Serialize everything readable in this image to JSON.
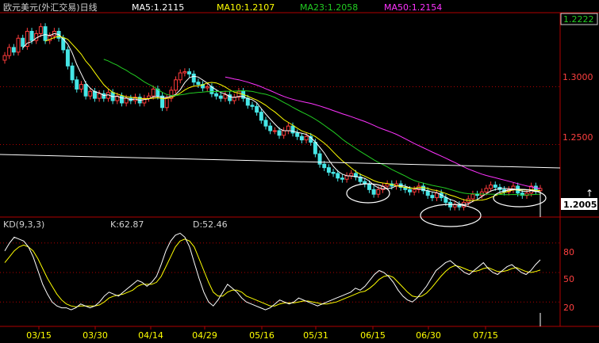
{
  "title": "欧元美元(外汇交易)日线",
  "header": {
    "ma5": "MA5:1.2115",
    "ma10": "MA10:1.2107",
    "ma23": "MA23:1.2058",
    "ma50": "MA50:1.2154"
  },
  "colors": {
    "background": "#000000",
    "frame": "#b00000",
    "up_candle": "#ff3c3c",
    "down_candle": "#46e6e6",
    "ma5": "#ffffff",
    "ma10": "#ffff00",
    "ma23": "#22cc22",
    "ma50": "#ff33ff",
    "title_text": "#d0d0d0",
    "ma5_text": "#ffffff",
    "ma10_text": "#ffff00",
    "ma23_text": "#22cc22",
    "ma50_text": "#ff33ff",
    "axis_text": "#ff4040",
    "date_text": "#ffff00",
    "k_line": "#ffffff",
    "d_line": "#ffff00",
    "trend_line": "#ffffff",
    "ellipse": "#ffffff"
  },
  "price_axis": {
    "ticks": [
      "1.3000",
      "1.2500"
    ],
    "last_price_box": "1.2222",
    "cursor_price": "1.2005"
  },
  "kd_panel": {
    "label": "KD(9,3,3)",
    "k": "K:62.87",
    "d": "D:52.46",
    "ticks": [
      "80",
      "50",
      "20"
    ]
  },
  "chart_data": {
    "type": "candlestick",
    "title": "欧元美元(外汇交易)日线",
    "x_ticks": [
      "03/15",
      "03/30",
      "04/14",
      "04/29",
      "05/16",
      "05/31",
      "06/15",
      "06/30",
      "07/15"
    ],
    "price_ylim": [
      1.19,
      1.36
    ],
    "price_ticks": [
      1.3,
      1.25
    ],
    "closes": [
      1.327,
      1.334,
      1.33,
      1.342,
      1.335,
      1.348,
      1.34,
      1.346,
      1.352,
      1.34,
      1.344,
      1.348,
      1.342,
      1.332,
      1.318,
      1.306,
      1.298,
      1.302,
      1.292,
      1.296,
      1.29,
      1.294,
      1.29,
      1.295,
      1.288,
      1.292,
      1.286,
      1.29,
      1.288,
      1.291,
      1.286,
      1.29,
      1.292,
      1.298,
      1.292,
      1.282,
      1.29,
      1.297,
      1.306,
      1.312,
      1.313,
      1.311,
      1.304,
      1.302,
      1.299,
      1.3,
      1.294,
      1.292,
      1.29,
      1.293,
      1.288,
      1.291,
      1.296,
      1.29,
      1.284,
      1.283,
      1.278,
      1.271,
      1.266,
      1.262,
      1.262,
      1.258,
      1.262,
      1.266,
      1.26,
      1.257,
      1.254,
      1.257,
      1.252,
      1.242,
      1.233,
      1.23,
      1.226,
      1.225,
      1.221,
      1.22,
      1.223,
      1.225,
      1.222,
      1.218,
      1.216,
      1.211,
      1.207,
      1.211,
      1.214,
      1.216,
      1.214,
      1.216,
      1.213,
      1.211,
      1.209,
      1.211,
      1.214,
      1.21,
      1.206,
      1.204,
      1.208,
      1.204,
      1.2,
      1.196,
      1.198,
      1.196,
      1.2,
      1.203,
      1.207,
      1.206,
      1.209,
      1.212,
      1.215,
      1.213,
      1.211,
      1.209,
      1.211,
      1.214,
      1.208,
      1.206,
      1.208,
      1.214,
      1.21,
      1.212
    ],
    "ma5": "MA5:1.2115",
    "ma10": "MA10:1.2107",
    "ma23": "MA23:1.2058",
    "ma50": "MA50:1.2154",
    "kd": {
      "ylim": [
        0,
        100
      ],
      "ticks": [
        80,
        50,
        20
      ],
      "k_last": 62.87,
      "d_last": 52.46,
      "k": [
        72,
        80,
        86,
        84,
        82,
        76,
        66,
        52,
        38,
        28,
        20,
        16,
        14,
        14,
        12,
        14,
        18,
        16,
        14,
        16,
        20,
        26,
        30,
        28,
        26,
        30,
        34,
        38,
        42,
        40,
        36,
        40,
        46,
        58,
        72,
        82,
        88,
        90,
        86,
        76,
        60,
        44,
        30,
        20,
        16,
        22,
        30,
        38,
        34,
        30,
        24,
        20,
        18,
        16,
        14,
        12,
        14,
        18,
        22,
        20,
        18,
        20,
        24,
        22,
        20,
        18,
        16,
        18,
        20,
        22,
        24,
        26,
        28,
        30,
        34,
        32,
        36,
        42,
        48,
        52,
        50,
        46,
        40,
        32,
        26,
        22,
        20,
        24,
        30,
        36,
        44,
        52,
        56,
        60,
        62,
        58,
        54,
        50,
        48,
        52,
        56,
        60,
        54,
        50,
        48,
        52,
        56,
        58,
        54,
        50,
        48,
        52,
        58,
        62.87
      ],
      "d": [
        60,
        66,
        72,
        76,
        78,
        76,
        72,
        64,
        54,
        44,
        36,
        28,
        22,
        18,
        16,
        15,
        16,
        16,
        16,
        16,
        17,
        20,
        24,
        26,
        27,
        28,
        30,
        32,
        36,
        38,
        38,
        38,
        40,
        46,
        56,
        66,
        76,
        82,
        84,
        82,
        76,
        64,
        52,
        40,
        30,
        26,
        26,
        30,
        32,
        32,
        30,
        26,
        24,
        22,
        20,
        18,
        16,
        16,
        18,
        19,
        19,
        19,
        20,
        21,
        21,
        20,
        19,
        18,
        18,
        19,
        20,
        22,
        24,
        26,
        28,
        30,
        31,
        34,
        38,
        43,
        46,
        47,
        45,
        40,
        35,
        30,
        26,
        25,
        26,
        29,
        34,
        40,
        46,
        51,
        55,
        57,
        56,
        54,
        52,
        51,
        52,
        54,
        55,
        53,
        51,
        51,
        52,
        54,
        55,
        53,
        51,
        50,
        51,
        52.46
      ]
    }
  }
}
